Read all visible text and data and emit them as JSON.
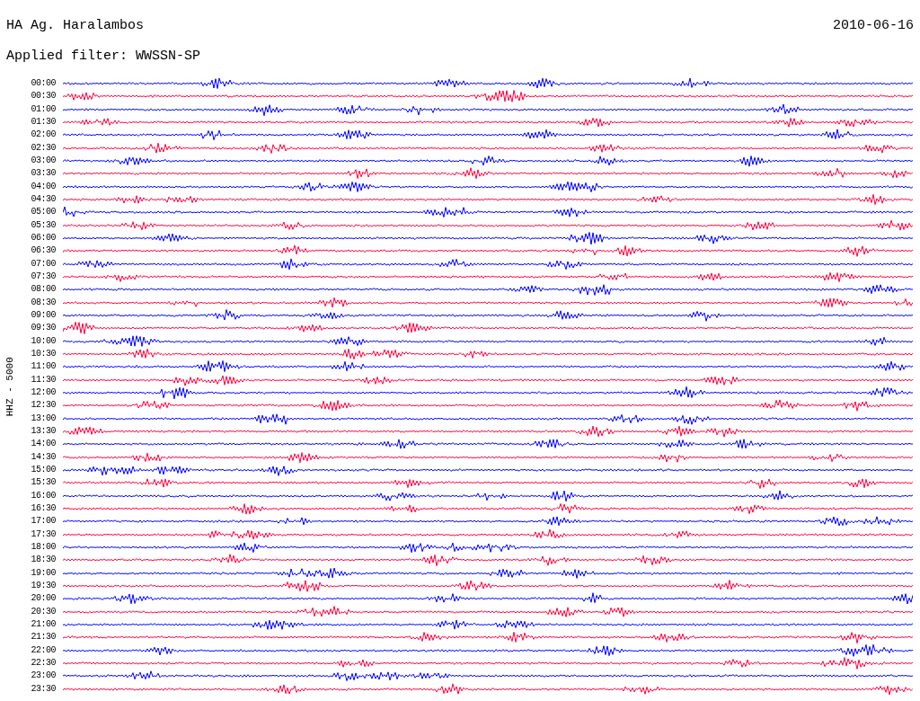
{
  "header": {
    "station": "HA Ag. Haralambos",
    "date": "2010-06-16",
    "filter": "Applied filter: WWSSN-SP"
  },
  "axis_label": "HHZ - 5000",
  "rows": [
    {
      "time": "00:00",
      "color": "#0000ff"
    },
    {
      "time": "00:30",
      "color": "#ff0040"
    },
    {
      "time": "01:00",
      "color": "#0000ff"
    },
    {
      "time": "01:30",
      "color": "#ff0040"
    },
    {
      "time": "02:00",
      "color": "#0000ff"
    },
    {
      "time": "02:30",
      "color": "#ff0040"
    },
    {
      "time": "03:00",
      "color": "#0000ff"
    },
    {
      "time": "03:30",
      "color": "#ff0040"
    },
    {
      "time": "04:00",
      "color": "#0000ff"
    },
    {
      "time": "04:30",
      "color": "#ff0040"
    },
    {
      "time": "05:00",
      "color": "#0000ff"
    },
    {
      "time": "05:30",
      "color": "#ff0040"
    },
    {
      "time": "06:00",
      "color": "#0000ff"
    },
    {
      "time": "06:30",
      "color": "#ff0040"
    },
    {
      "time": "07:00",
      "color": "#0000ff"
    },
    {
      "time": "07:30",
      "color": "#ff0040"
    },
    {
      "time": "08:00",
      "color": "#0000ff"
    },
    {
      "time": "08:30",
      "color": "#ff0040"
    },
    {
      "time": "09:00",
      "color": "#0000ff"
    },
    {
      "time": "09:30",
      "color": "#ff0040"
    },
    {
      "time": "10:00",
      "color": "#0000ff"
    },
    {
      "time": "10:30",
      "color": "#ff0040"
    },
    {
      "time": "11:00",
      "color": "#0000ff"
    },
    {
      "time": "11:30",
      "color": "#ff0040"
    },
    {
      "time": "12:00",
      "color": "#0000ff"
    },
    {
      "time": "12:30",
      "color": "#ff0040"
    },
    {
      "time": "13:00",
      "color": "#0000ff"
    },
    {
      "time": "13:30",
      "color": "#ff0040"
    },
    {
      "time": "14:00",
      "color": "#0000ff"
    },
    {
      "time": "14:30",
      "color": "#ff0040"
    },
    {
      "time": "15:00",
      "color": "#0000ff"
    },
    {
      "time": "15:30",
      "color": "#ff0040"
    },
    {
      "time": "16:00",
      "color": "#0000ff"
    },
    {
      "time": "16:30",
      "color": "#ff0040"
    },
    {
      "time": "17:00",
      "color": "#0000ff"
    },
    {
      "time": "17:30",
      "color": "#ff0040"
    },
    {
      "time": "18:00",
      "color": "#0000ff"
    },
    {
      "time": "18:30",
      "color": "#ff0040"
    },
    {
      "time": "19:00",
      "color": "#0000ff"
    },
    {
      "time": "19:30",
      "color": "#ff0040"
    },
    {
      "time": "20:00",
      "color": "#0000ff"
    },
    {
      "time": "20:30",
      "color": "#ff0040"
    },
    {
      "time": "21:00",
      "color": "#0000ff"
    },
    {
      "time": "21:30",
      "color": "#ff0040"
    },
    {
      "time": "22:00",
      "color": "#0000ff"
    },
    {
      "time": "22:30",
      "color": "#ff0040"
    },
    {
      "time": "23:00",
      "color": "#0000ff"
    },
    {
      "time": "23:30",
      "color": "#ff0040"
    }
  ]
}
